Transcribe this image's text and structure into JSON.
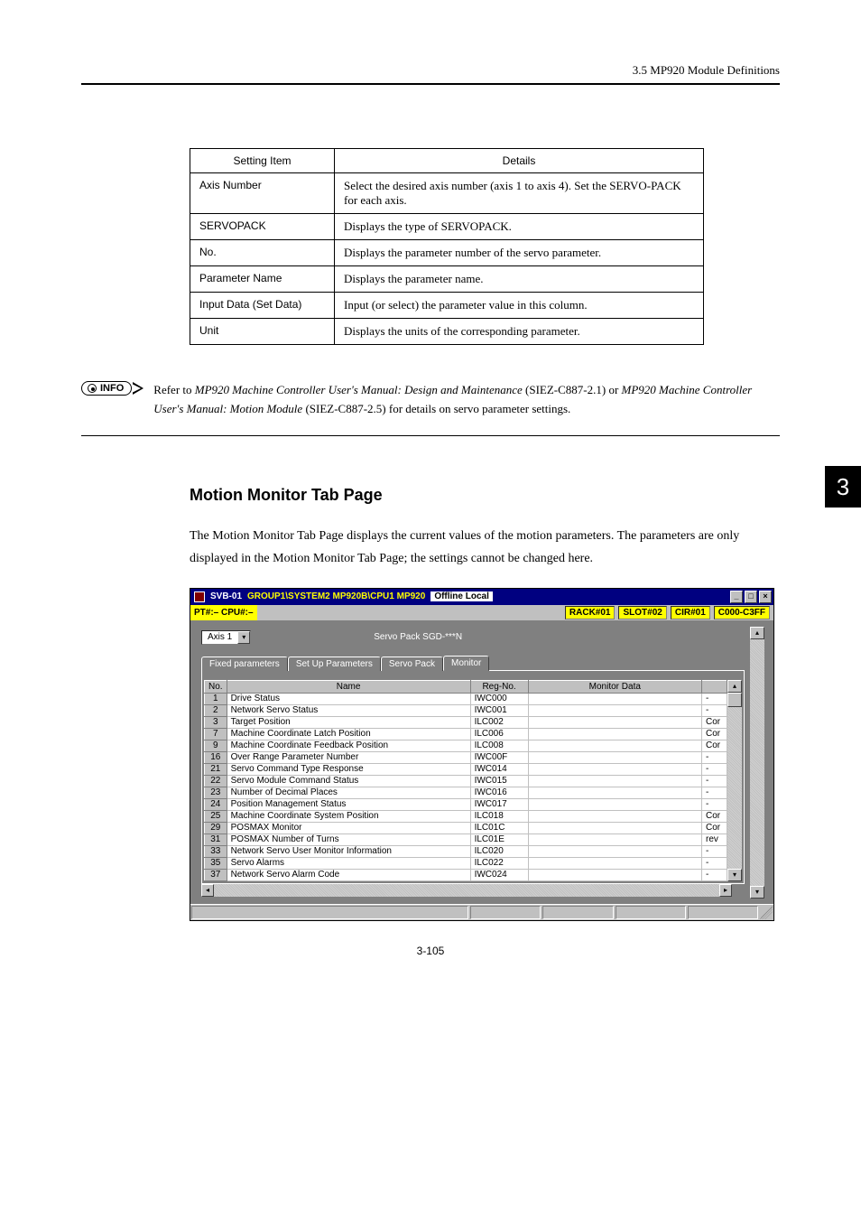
{
  "header": {
    "breadcrumb": "3.5 MP920 Module Definitions"
  },
  "settings_table": {
    "head": {
      "item": "Setting Item",
      "details": "Details"
    },
    "rows": [
      {
        "item": "Axis Number",
        "details": "Select the desired axis number (axis 1 to axis 4). Set the SERVO-PACK for each axis."
      },
      {
        "item": "SERVOPACK",
        "details": "Displays the type of SERVOPACK."
      },
      {
        "item": "No.",
        "details": "Displays the parameter number of the servo parameter."
      },
      {
        "item": "Parameter Name",
        "details": "Displays the parameter name."
      },
      {
        "item": "Input Data (Set Data)",
        "details": "Input (or select) the parameter value in this column."
      },
      {
        "item": "Unit",
        "details": "Displays the units of the corresponding parameter."
      }
    ]
  },
  "info": {
    "badge": "INFO",
    "pre": "Refer to ",
    "ital1": "MP920 Machine Controller User's Manual: Design and Maintenance",
    "mid1": " (SIEZ-C887-2.1) or ",
    "ital2": "MP920 Machine Controller User's Manual: Motion Module",
    "post": " (SIEZ-C887-2.5) for details on servo parameter settings."
  },
  "section": {
    "heading": "Motion Monitor Tab Page",
    "body": "The Motion Monitor Tab Page displays the current values of the motion parameters. The parameters are only displayed in the Motion Monitor Tab Page; the settings cannot be changed here."
  },
  "side_tab": "3",
  "screenshot": {
    "title_prefix": "SVB-01",
    "title_path": "GROUP1\\SYSTEM2 MP920B\\CPU1 MP920",
    "title_mode": "Offline Local",
    "pt_label": "PT#:– CPU#:–",
    "rack": "RACK#01",
    "slot": "SLOT#02",
    "cir": "CIR#01",
    "range": "C000-C3FF",
    "axis_value": "Axis 1",
    "servo_label": "Servo Pack SGD-***N",
    "tabs": [
      "Fixed parameters",
      "Set Up Parameters",
      "Servo Pack",
      "Monitor"
    ],
    "columns": {
      "no": "No.",
      "name": "Name",
      "reg": "Reg-No.",
      "mon": "Monitor Data"
    },
    "rows": [
      {
        "no": "1",
        "name": "Drive Status",
        "reg": "IWC000",
        "mon": "",
        "extra": "-"
      },
      {
        "no": "2",
        "name": "Network Servo Status",
        "reg": "IWC001",
        "mon": "",
        "extra": "-"
      },
      {
        "no": "3",
        "name": "Target Position",
        "reg": "ILC002",
        "mon": "",
        "extra": "Cor"
      },
      {
        "no": "7",
        "name": "Machine Coordinate Latch Position",
        "reg": "ILC006",
        "mon": "",
        "extra": "Cor"
      },
      {
        "no": "9",
        "name": "Machine Coordinate Feedback Position",
        "reg": "ILC008",
        "mon": "",
        "extra": "Cor"
      },
      {
        "no": "16",
        "name": "Over Range Parameter Number",
        "reg": "IWC00F",
        "mon": "",
        "extra": "-"
      },
      {
        "no": "21",
        "name": "Servo Command Type Response",
        "reg": "IWC014",
        "mon": "",
        "extra": "-"
      },
      {
        "no": "22",
        "name": "Servo Module Command Status",
        "reg": "IWC015",
        "mon": "",
        "extra": "-"
      },
      {
        "no": "23",
        "name": "Number of Decimal Places",
        "reg": "IWC016",
        "mon": "",
        "extra": "-"
      },
      {
        "no": "24",
        "name": "Position Management Status",
        "reg": "IWC017",
        "mon": "",
        "extra": "-"
      },
      {
        "no": "25",
        "name": "Machine Coordinate System Position",
        "reg": "ILC018",
        "mon": "",
        "extra": "Cor"
      },
      {
        "no": "29",
        "name": "POSMAX Monitor",
        "reg": "ILC01C",
        "mon": "",
        "extra": "Cor"
      },
      {
        "no": "31",
        "name": "POSMAX Number of Turns",
        "reg": "ILC01E",
        "mon": "",
        "extra": "rev"
      },
      {
        "no": "33",
        "name": "Network Servo User Monitor Information",
        "reg": "ILC020",
        "mon": "",
        "extra": "-"
      },
      {
        "no": "35",
        "name": "Servo Alarms",
        "reg": "ILC022",
        "mon": "",
        "extra": "-"
      },
      {
        "no": "37",
        "name": "Network Servo Alarm Code",
        "reg": "IWC024",
        "mon": "",
        "extra": "-"
      }
    ]
  },
  "page_number": "3-105"
}
